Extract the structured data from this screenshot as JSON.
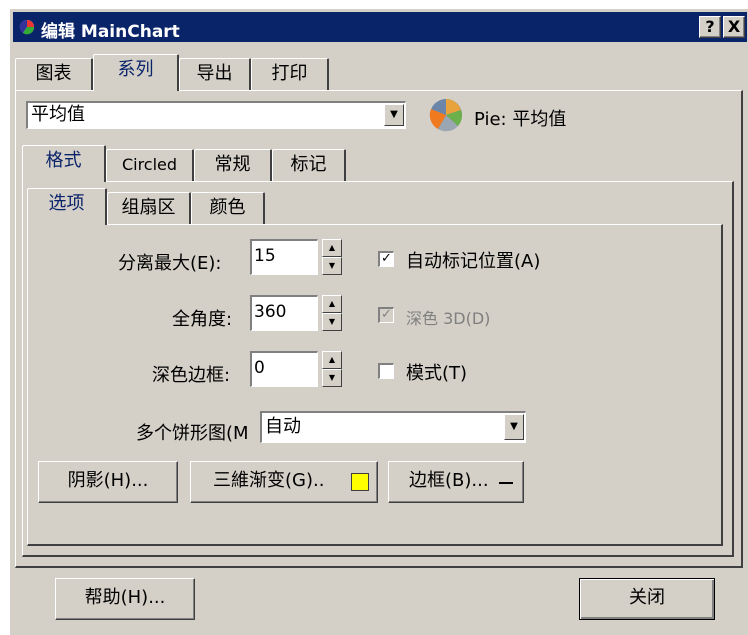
{
  "window": {
    "title": "编辑 MainChart",
    "help_btn": "?",
    "close_btn": "X"
  },
  "main_tabs": [
    "图表",
    "系列",
    "导出",
    "打印"
  ],
  "series_select": {
    "value": "平均值",
    "preview_label": "Pie: 平均值"
  },
  "series_tabs": [
    "格式",
    "Circled",
    "常规",
    "标记"
  ],
  "format_tabs": [
    "选项",
    "组扇区",
    "颜色"
  ],
  "fields": {
    "explode_label": "分离最大(E):",
    "explode_value": "15",
    "angle_label": "全角度:",
    "angle_value": "360",
    "dark_pen_label": "深色边框:",
    "dark_pen_value": "0",
    "multi_pie_label": "多个饼形图(M",
    "multi_pie_value": "自动"
  },
  "checkboxes": {
    "auto_mark": {
      "label": "自动标记位置(A)",
      "checked": true
    },
    "dark3d": {
      "label": "深色 3D(D)",
      "checked": true,
      "disabled": true
    },
    "pattern": {
      "label": "模式(T)",
      "checked": false
    }
  },
  "buttons": {
    "shadow": "阴影(H)...",
    "gradient": "三維渐变(G)..",
    "border": "边框(B)...",
    "help": "帮助(H)...",
    "close": "关闭"
  },
  "colors": {
    "titlebar": "#0a246a",
    "face": "#d4d0c8",
    "gradient_swatch": "#ffff00"
  }
}
